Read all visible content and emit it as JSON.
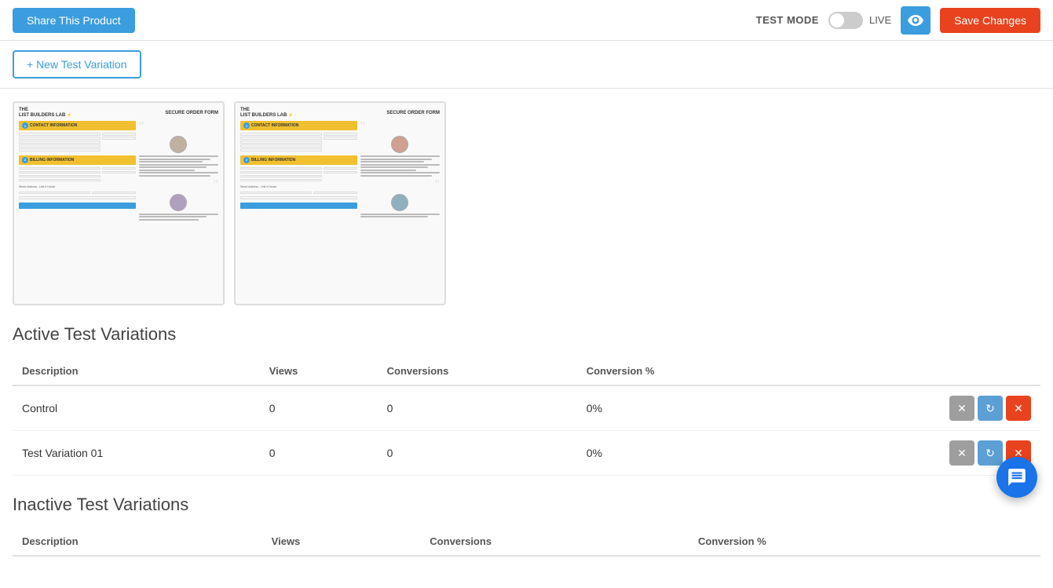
{
  "header": {
    "share_label": "Share This Product",
    "test_mode_label": "TEST MODE",
    "live_label": "LIVE",
    "preview_label": "Preview",
    "save_label": "Save Changes"
  },
  "sub_header": {
    "new_variation_label": "+ New Test Variation"
  },
  "thumbnails": [
    {
      "id": "thumb-1",
      "alt": "Control variation preview"
    },
    {
      "id": "thumb-2",
      "alt": "Test variation 01 preview"
    }
  ],
  "active_section": {
    "title": "Active Test Variations",
    "columns": {
      "description": "Description",
      "views": "Views",
      "conversions": "Conversions",
      "conversion_pct": "Conversion %"
    },
    "rows": [
      {
        "description": "Control",
        "views": "0",
        "conversions": "0",
        "conversion_pct": "0%"
      },
      {
        "description": "Test Variation 01",
        "views": "0",
        "conversions": "0",
        "conversion_pct": "0%"
      }
    ]
  },
  "inactive_section": {
    "title": "Inactive Test Variations",
    "columns": {
      "description": "Description",
      "views": "Views",
      "conversions": "Conversions",
      "conversion_pct": "Conversion %"
    },
    "rows": []
  },
  "actions": {
    "cancel_icon": "✕",
    "refresh_icon": "↻",
    "delete_icon": "✕"
  }
}
